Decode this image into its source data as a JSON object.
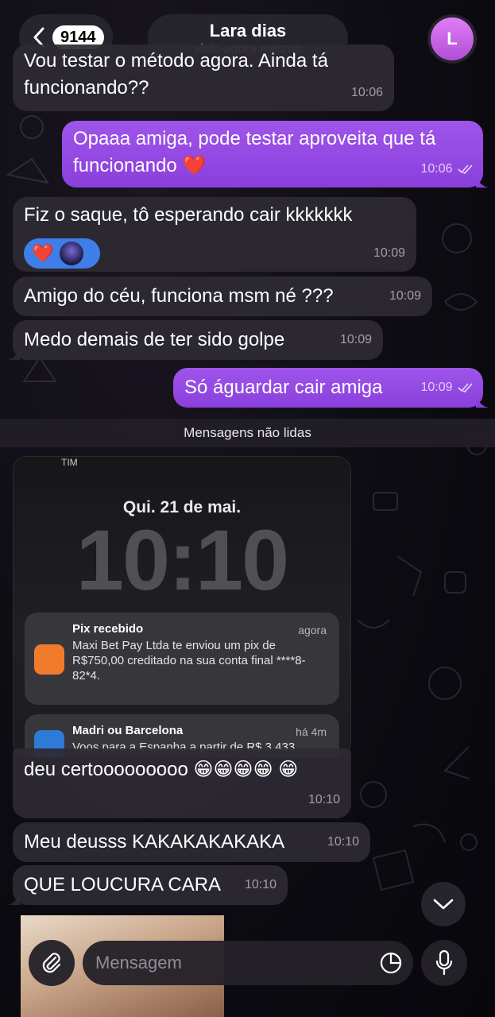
{
  "header": {
    "unread_count": "9144",
    "contact_name": "Lara dias",
    "status": "visto agora mesmo",
    "avatar_initial": "L"
  },
  "messages": [
    {
      "dir": "in",
      "text": "Vou testar o método agora. Ainda tá funcionando??",
      "time": "10:06"
    },
    {
      "dir": "out",
      "text": "Opaaa amiga, pode testar aproveita que tá funcionando ❤️",
      "time": "10:06"
    },
    {
      "dir": "in",
      "text": "Fiz o saque, tô esperando cair kkkkkkk",
      "time": "10:09",
      "reaction": "❤️"
    },
    {
      "dir": "in",
      "text": "Amigo do céu, funciona msm né ???",
      "time": "10:09"
    },
    {
      "dir": "in",
      "text": "Medo demais de ter sido golpe",
      "time": "10:09"
    },
    {
      "dir": "out",
      "text": "Só águardar cair amiga",
      "time": "10:09"
    },
    {
      "dir": "in",
      "text": "deu certooooooooo 😁😁😁😁 😁",
      "time": "10:10"
    },
    {
      "dir": "in",
      "text": "Meu deusss KAKAKAKAKAKA",
      "time": "10:10"
    },
    {
      "dir": "in",
      "text": "QUE LOUCURA CARA",
      "time": "10:10"
    }
  ],
  "unread_divider": "Mensagens não lidas",
  "photo": {
    "status_left": "TIM",
    "date": "Qui. 21 de mai.",
    "clock": "10:10",
    "notifications": [
      {
        "title": "Pix recebido",
        "ago": "agora",
        "body": "Maxi Bet Pay Ltda te enviou um pix de R$750,00 creditado na sua conta final ****8-82*4."
      },
      {
        "title": "Madri ou Barcelona",
        "ago": "há 4m",
        "body": "Voos para a Espanha a partir de R$ 3.433"
      }
    ]
  },
  "composer": {
    "placeholder": "Mensagem"
  },
  "colors": {
    "outgoing": "#9f55ea",
    "incoming": "#2e2a34",
    "reaction": "#3f7ee8"
  }
}
